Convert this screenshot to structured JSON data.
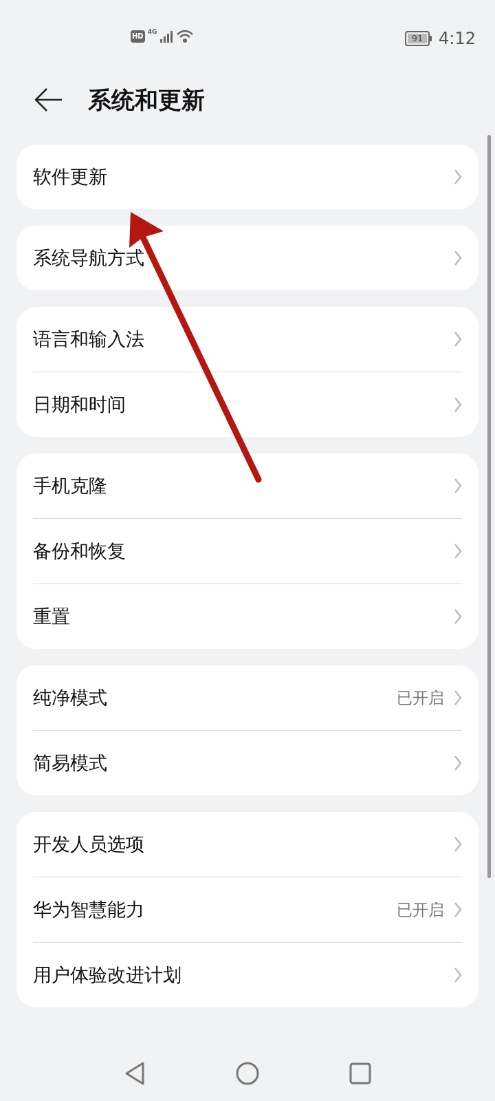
{
  "status_bar": {
    "hd": "HD",
    "network": "4G",
    "battery": "91",
    "time": "4:12"
  },
  "header": {
    "title": "系统和更新"
  },
  "groups": [
    {
      "items": [
        {
          "label": "软件更新"
        }
      ]
    },
    {
      "items": [
        {
          "label": "系统导航方式"
        }
      ]
    },
    {
      "items": [
        {
          "label": "语言和输入法"
        },
        {
          "label": "日期和时间"
        }
      ]
    },
    {
      "items": [
        {
          "label": "手机克隆"
        },
        {
          "label": "备份和恢复"
        },
        {
          "label": "重置"
        }
      ]
    },
    {
      "items": [
        {
          "label": "纯净模式",
          "value": "已开启"
        },
        {
          "label": "简易模式"
        }
      ]
    },
    {
      "items": [
        {
          "label": "开发人员选项"
        },
        {
          "label": "华为智慧能力",
          "value": "已开启"
        },
        {
          "label": "用户体验改进计划"
        }
      ]
    }
  ]
}
